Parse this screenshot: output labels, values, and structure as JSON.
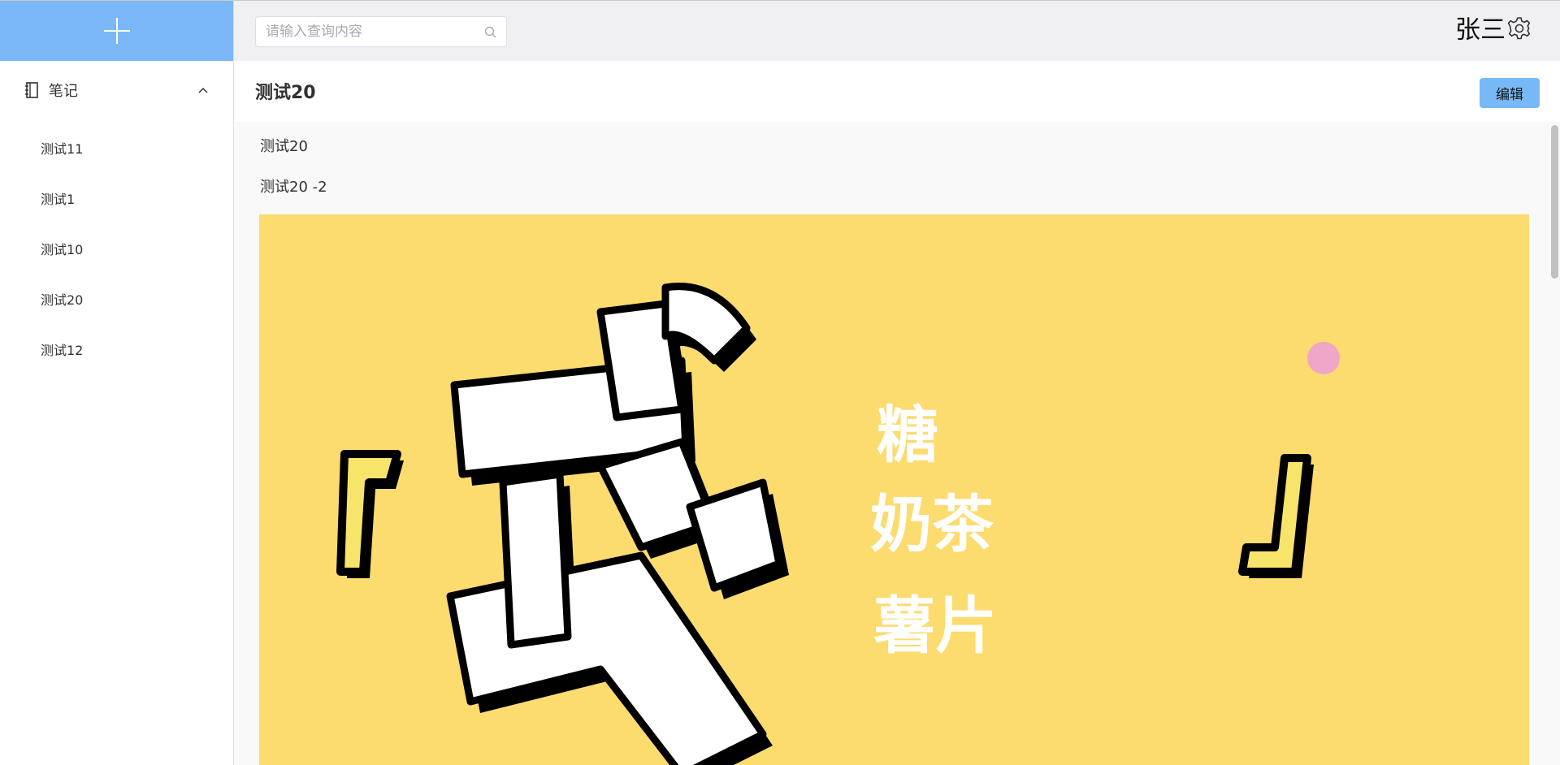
{
  "sidebar": {
    "add_label": "+",
    "section_title": "笔记",
    "items": [
      {
        "label": "测试11"
      },
      {
        "label": "测试1"
      },
      {
        "label": "测试10"
      },
      {
        "label": "测试20"
      },
      {
        "label": "测试12"
      }
    ]
  },
  "header": {
    "search_placeholder": "请输入查询内容",
    "search_value": "",
    "username": "张三"
  },
  "document": {
    "title": "测试20",
    "edit_label": "编辑",
    "lines": [
      "测试20",
      "测试20 -2"
    ],
    "image_text": {
      "big_char": "戒",
      "items": [
        "糖",
        "奶茶",
        "薯片"
      ],
      "left_bracket": "『",
      "right_bracket": "』"
    }
  },
  "colors": {
    "accent": "#7bb8f7",
    "topbar_bg": "#f0f0f2",
    "poster_bg": "#fcdb6f",
    "float_badge": "#f0a6c6"
  }
}
